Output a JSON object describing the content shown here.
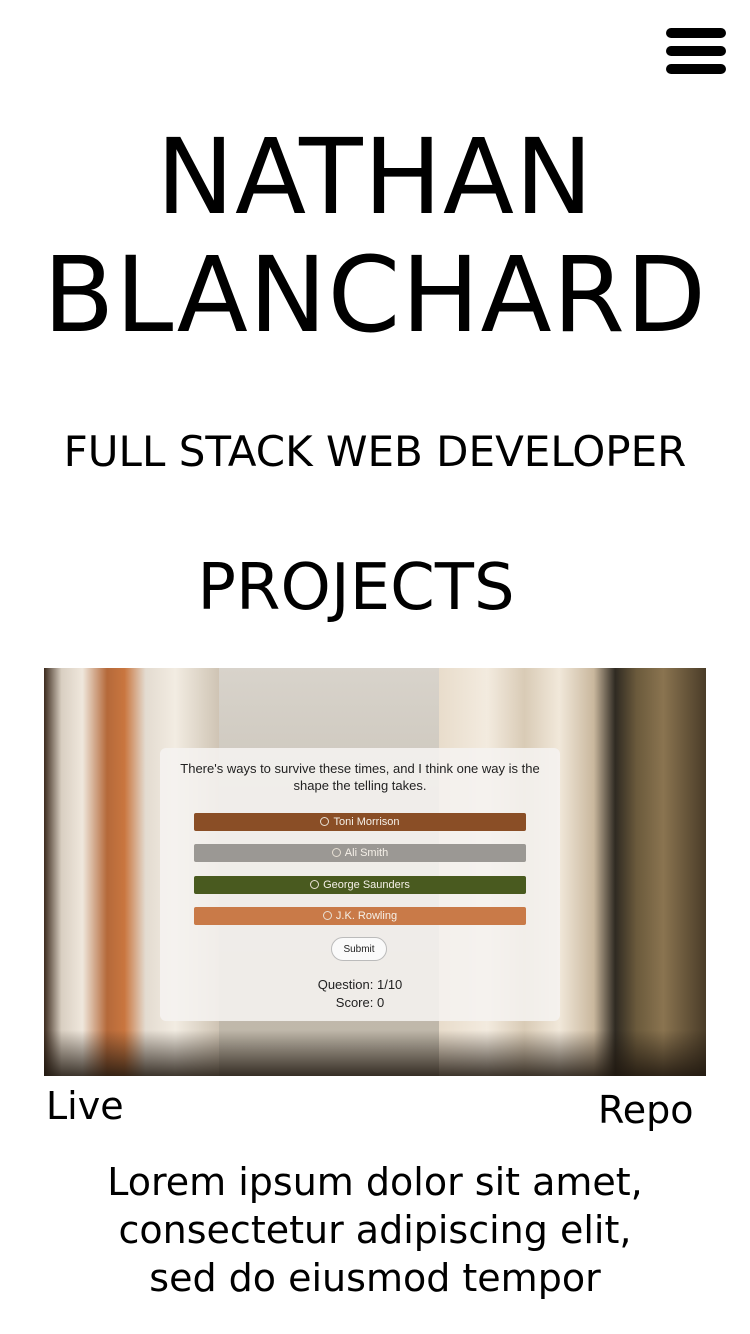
{
  "header": {
    "menu_icon": "hamburger-menu-icon",
    "name_line1": "NATHAN",
    "name_line2": "BLANCHARD",
    "subtitle": "FULL STACK WEB DEVELOPER"
  },
  "projects": {
    "section_title": "PROJECTS",
    "items": [
      {
        "screenshot": {
          "question": "There's ways to survive these times, and I think one way is the shape the telling takes.",
          "options": [
            {
              "label": "Toni Morrison",
              "color": "#8a4e26"
            },
            {
              "label": "Ali Smith",
              "color": "#9b9894"
            },
            {
              "label": "George Saunders",
              "color": "#495a1f"
            },
            {
              "label": "J.K. Rowling",
              "color": "#c97a48"
            }
          ],
          "submit_label": "Submit",
          "question_counter": "Question: 1/10",
          "score": "Score: 0"
        },
        "live_label": "Live",
        "repo_label": "Repo",
        "description": "Lorem ipsum dolor sit amet, consectetur adipiscing elit, sed do eiusmod tempor"
      }
    ]
  }
}
